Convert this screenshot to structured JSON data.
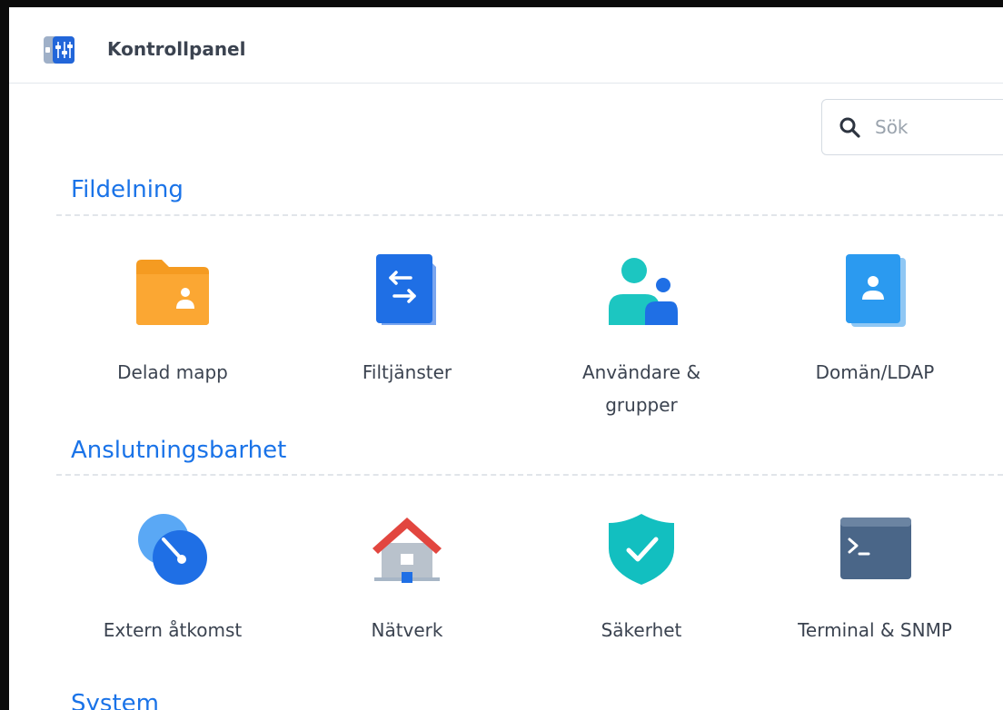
{
  "window": {
    "title": "Kontrollpanel",
    "app_icon": "control-panel-icon"
  },
  "search": {
    "placeholder": "Sök",
    "icon": "search-icon"
  },
  "sections": [
    {
      "title": "Fildelning",
      "items": [
        {
          "label": "Delad mapp",
          "icon": "shared-folder-icon"
        },
        {
          "label": "Filtjänster",
          "icon": "file-services-icon"
        },
        {
          "label": "Användare & grupper",
          "icon": "users-groups-icon"
        },
        {
          "label": "Domän/LDAP",
          "icon": "domain-ldap-icon"
        }
      ]
    },
    {
      "title": "Anslutningsbarhet",
      "items": [
        {
          "label": "Extern åtkomst",
          "icon": "external-access-icon"
        },
        {
          "label": "Nätverk",
          "icon": "network-icon"
        },
        {
          "label": "Säkerhet",
          "icon": "security-shield-icon"
        },
        {
          "label": "Terminal & SNMP",
          "icon": "terminal-icon"
        }
      ]
    },
    {
      "title": "System"
    }
  ],
  "colors": {
    "accent": "#1a73e8",
    "text": "#3b4350"
  }
}
